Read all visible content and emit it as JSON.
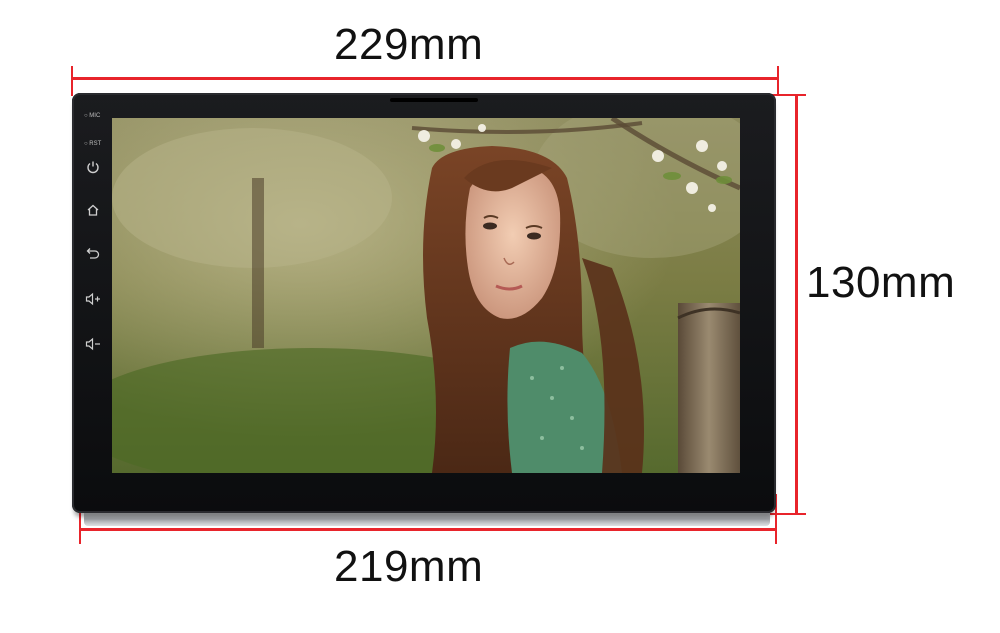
{
  "dimensions": {
    "top_width": "229mm",
    "right_height": "130mm",
    "bottom_width": "219mm"
  },
  "side_panel": {
    "mic_label": "MIC",
    "rst_label": "RST",
    "buttons": [
      "power-icon",
      "home-icon",
      "back-icon",
      "volume-up-icon",
      "volume-down-icon"
    ]
  },
  "colors": {
    "dimension_line": "#e8242b",
    "bezel": "#0b0c0e"
  }
}
